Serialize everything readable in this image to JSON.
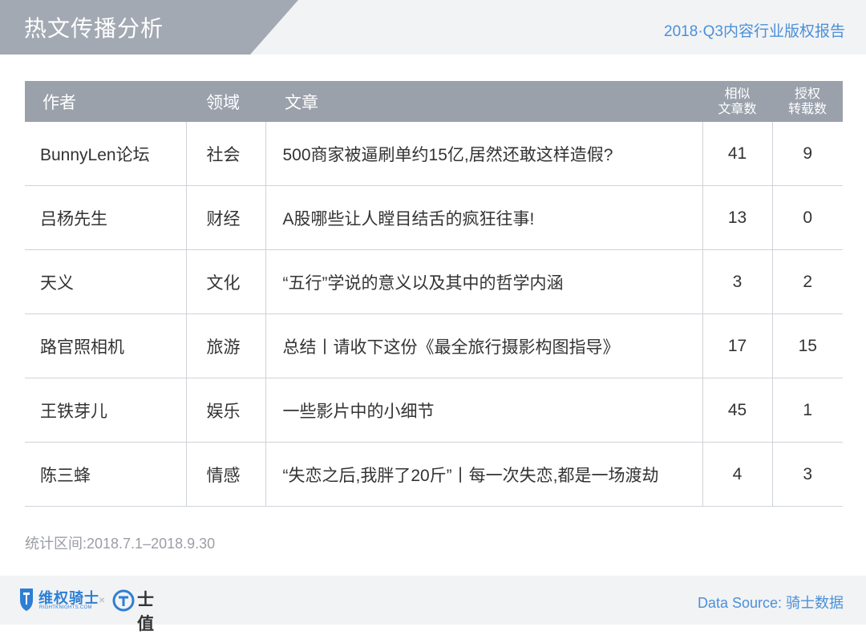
{
  "header": {
    "title": "热文传播分析",
    "report": "2018·Q3内容行业版权报告"
  },
  "table": {
    "headers": {
      "author": "作者",
      "field": "领域",
      "article": "文章",
      "similar_line1": "相似",
      "similar_line2": "文章数",
      "licensed_line1": "授权",
      "licensed_line2": "转载数"
    },
    "rows": [
      {
        "author": "BunnyLen论坛",
        "field": "社会",
        "article": "500商家被逼刷单约15亿,居然还敢这样造假?",
        "similar": "41",
        "licensed": "9"
      },
      {
        "author": "吕杨先生",
        "field": "财经",
        "article": "A股哪些让人瞠目结舌的疯狂往事!",
        "similar": "13",
        "licensed": "0"
      },
      {
        "author": "天义",
        "field": "文化",
        "article": "“五行”学说的意义以及其中的哲学内涵",
        "similar": "3",
        "licensed": "2"
      },
      {
        "author": "路官照相机",
        "field": "旅游",
        "article": "总结丨请收下这份《最全旅行摄影构图指导》",
        "similar": "17",
        "licensed": "15"
      },
      {
        "author": "王铁芽儿",
        "field": "娱乐",
        "article": "一些影片中的小细节",
        "similar": "45",
        "licensed": "1"
      },
      {
        "author": "陈三蜂",
        "field": "情感",
        "article": "“失恋之后,我胖了20斤”丨每一次失恋,都是一场渡劫",
        "similar": "4",
        "licensed": "3"
      }
    ]
  },
  "period": "统计区间:2018.7.1–2018.9.30",
  "footer": {
    "logo1_name": "维权骑士",
    "logo1_sub": "RIGHTKNIGHTS.COM",
    "times": "×",
    "logo2_name": "士值",
    "source": "Data Source: 骑士数据",
    "icons": [
      "shield-logo-icon",
      "ring-logo-icon"
    ],
    "colors": {
      "accent": "#4a90d9",
      "header_bar": "#9aa1ab",
      "logo_blue": "#2d7fd3"
    }
  }
}
